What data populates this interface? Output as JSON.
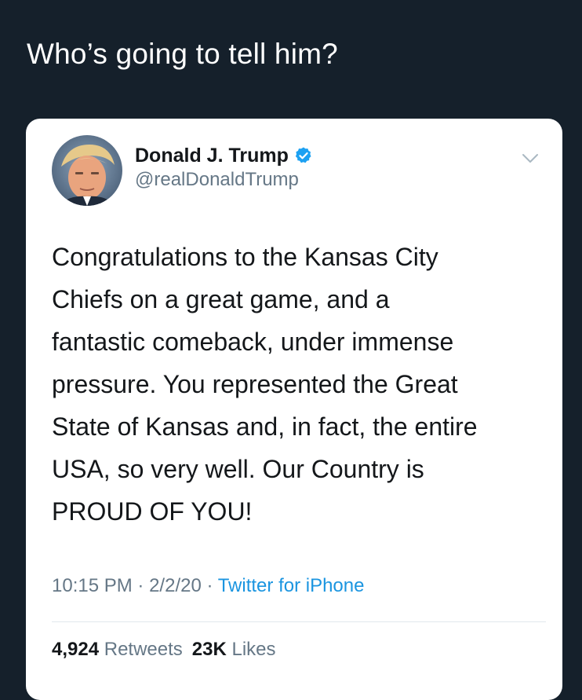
{
  "caption": "Who’s going to tell him?",
  "tweet": {
    "author_name": "Donald J. Trump",
    "author_handle": "@realDonaldTrump",
    "text_lines": [
      "Congratulations to the Kansas City",
      "Chiefs on a great game, and a",
      "fantastic comeback, under immense",
      "pressure. You represented the Great",
      "State of Kansas and, in fact, the entire",
      "USA, so very well. Our Country is",
      "PROUD OF YOU!"
    ],
    "time": "10:15 PM",
    "date": "2/2/20",
    "separator": "·",
    "source": "Twitter for iPhone",
    "retweets_count": "4,924",
    "retweets_label": "Retweets",
    "likes_count": "23K",
    "likes_label": "Likes"
  },
  "icons": {
    "verified": "verified-badge-icon",
    "more": "chevron-down-icon"
  },
  "colors": {
    "background": "#15202b",
    "card": "#ffffff",
    "text": "#14171a",
    "secondary": "#657786",
    "link": "#1b95e0",
    "verified": "#1da1f2"
  }
}
